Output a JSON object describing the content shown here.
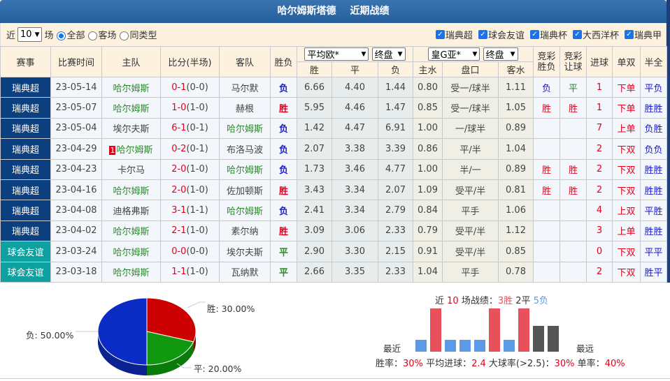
{
  "title": {
    "team": "哈尔姆斯塔德",
    "section": "近期战绩"
  },
  "team_short": "哈尔姆斯",
  "filter": {
    "prefix": "近",
    "count": "10",
    "suffix": "场",
    "radios": [
      {
        "label": "全部",
        "checked": true
      },
      {
        "label": "客场",
        "checked": false
      },
      {
        "label": "同类型",
        "checked": false
      }
    ],
    "leagues": [
      {
        "label": "瑞典超",
        "checked": true
      },
      {
        "label": "球会友谊",
        "checked": true
      },
      {
        "label": "瑞典杯",
        "checked": true
      },
      {
        "label": "大西洋杯",
        "checked": true
      },
      {
        "label": "瑞典甲",
        "checked": true
      }
    ]
  },
  "headers": {
    "league": "赛事",
    "time": "比赛时间",
    "home": "主队",
    "score": "比分(半场)",
    "away": "客队",
    "result": "胜负",
    "euro_select": "平均欧*",
    "euro_type": "终盘",
    "asia_select": "皇G亚*",
    "asia_type": "终盘",
    "win": "胜",
    "draw": "平",
    "lose": "负",
    "home_water": "主水",
    "handicap": "盘口",
    "away_water": "客水",
    "jc_result": "竞彩胜负",
    "jc_handicap": "竞彩让球",
    "goals": "进球",
    "oddeven": "单双",
    "htft": "半全"
  },
  "rows": [
    {
      "league": "瑞典超",
      "friendly": false,
      "date": "23-05-14",
      "home": "哈尔姆斯",
      "badge": "",
      "ft": "0-1",
      "ht": "(0-0)",
      "away": "马尔默",
      "result": "负",
      "w": "6.66",
      "d": "4.40",
      "l": "1.44",
      "hw": "0.80",
      "hc": "受一/球半",
      "aw": "1.11",
      "jc1": "负",
      "jc2": "平",
      "goals": "1",
      "oe": "下单",
      "htft": "平负"
    },
    {
      "league": "瑞典超",
      "friendly": false,
      "date": "23-05-07",
      "home": "哈尔姆斯",
      "badge": "",
      "ft": "1-0",
      "ht": "(1-0)",
      "away": "赫根",
      "result": "胜",
      "w": "5.95",
      "d": "4.46",
      "l": "1.47",
      "hw": "0.85",
      "hc": "受一/球半",
      "aw": "1.05",
      "jc1": "胜",
      "jc2": "胜",
      "goals": "1",
      "oe": "下单",
      "htft": "胜胜"
    },
    {
      "league": "瑞典超",
      "friendly": false,
      "date": "23-05-04",
      "home": "埃尔夫斯",
      "badge": "",
      "ft": "6-1",
      "ht": "(0-1)",
      "away": "哈尔姆斯",
      "result": "负",
      "w": "1.42",
      "d": "4.47",
      "l": "6.91",
      "hw": "1.00",
      "hc": "一/球半",
      "aw": "0.89",
      "jc1": "",
      "jc2": "",
      "goals": "7",
      "oe": "上单",
      "htft": "负胜"
    },
    {
      "league": "瑞典超",
      "friendly": false,
      "date": "23-04-29",
      "home": "哈尔姆斯",
      "badge": "1",
      "ft": "0-2",
      "ht": "(0-1)",
      "away": "布洛马波",
      "result": "负",
      "w": "2.07",
      "d": "3.38",
      "l": "3.39",
      "hw": "0.86",
      "hc": "平/半",
      "aw": "1.04",
      "jc1": "",
      "jc2": "",
      "goals": "2",
      "oe": "下双",
      "htft": "负负"
    },
    {
      "league": "瑞典超",
      "friendly": false,
      "date": "23-04-23",
      "home": "卡尔马",
      "badge": "",
      "ft": "2-0",
      "ht": "(1-0)",
      "away": "哈尔姆斯",
      "result": "负",
      "w": "1.73",
      "d": "3.46",
      "l": "4.77",
      "hw": "1.00",
      "hc": "半/一",
      "aw": "0.89",
      "jc1": "胜",
      "jc2": "胜",
      "goals": "2",
      "oe": "下双",
      "htft": "胜胜"
    },
    {
      "league": "瑞典超",
      "friendly": false,
      "date": "23-04-16",
      "home": "哈尔姆斯",
      "badge": "",
      "ft": "2-0",
      "ht": "(1-0)",
      "away": "佐加顿斯",
      "result": "胜",
      "w": "3.43",
      "d": "3.34",
      "l": "2.07",
      "hw": "1.09",
      "hc": "受平/半",
      "aw": "0.81",
      "jc1": "胜",
      "jc2": "胜",
      "goals": "2",
      "oe": "下双",
      "htft": "胜胜"
    },
    {
      "league": "瑞典超",
      "friendly": false,
      "date": "23-04-08",
      "home": "迪格弗斯",
      "badge": "",
      "ft": "3-1",
      "ht": "(1-1)",
      "away": "哈尔姆斯",
      "result": "负",
      "w": "2.41",
      "d": "3.34",
      "l": "2.79",
      "hw": "0.84",
      "hc": "平手",
      "aw": "1.06",
      "jc1": "",
      "jc2": "",
      "goals": "4",
      "oe": "上双",
      "htft": "平胜"
    },
    {
      "league": "瑞典超",
      "friendly": false,
      "date": "23-04-02",
      "home": "哈尔姆斯",
      "badge": "",
      "ft": "2-1",
      "ht": "(1-0)",
      "away": "素尔纳",
      "result": "胜",
      "w": "3.09",
      "d": "3.06",
      "l": "2.33",
      "hw": "0.79",
      "hc": "受平/半",
      "aw": "1.12",
      "jc1": "",
      "jc2": "",
      "goals": "3",
      "oe": "上单",
      "htft": "胜胜"
    },
    {
      "league": "球会友谊",
      "friendly": true,
      "date": "23-03-24",
      "home": "哈尔姆斯",
      "badge": "",
      "ft": "0-0",
      "ht": "(0-0)",
      "away": "埃尔夫斯",
      "result": "平",
      "w": "2.90",
      "d": "3.30",
      "l": "2.15",
      "hw": "0.91",
      "hc": "受平/半",
      "aw": "0.85",
      "jc1": "",
      "jc2": "",
      "goals": "0",
      "oe": "下双",
      "htft": "平平"
    },
    {
      "league": "球会友谊",
      "friendly": true,
      "date": "23-03-18",
      "home": "哈尔姆斯",
      "badge": "",
      "ft": "1-1",
      "ht": "(1-0)",
      "away": "瓦纳默",
      "result": "平",
      "w": "2.66",
      "d": "3.35",
      "l": "2.33",
      "hw": "1.04",
      "hc": "平手",
      "aw": "0.78",
      "jc1": "",
      "jc2": "",
      "goals": "2",
      "oe": "下双",
      "htft": "胜平"
    }
  ],
  "pie": {
    "slices": [
      {
        "label": "胜",
        "value": 30,
        "text": "胜: 30.00%",
        "color": "#cc0000",
        "side": "#990000"
      },
      {
        "label": "平",
        "value": 20,
        "text": "平: 20.00%",
        "color": "#109910",
        "side": "#0a7a0a"
      },
      {
        "label": "负",
        "value": 50,
        "text": "负: 50.00%",
        "color": "#0a2bc4",
        "side": "#0a2290"
      }
    ]
  },
  "summary": {
    "p1": "近",
    "count": "10",
    "p2": "场战绩：",
    "wins": "3胜",
    "draws": "2平",
    "losses": "5负",
    "recent": "最近",
    "oldest": "最远",
    "win_rate_label": "胜率：",
    "win_rate": "30%",
    "avg_goals_label": "平均进球：",
    "avg_goals": "2.4",
    "over_label": "大球率(>2.5)：",
    "over_rate": "30%",
    "odd_label": "单率：",
    "odd_rate": "40%",
    "results": [
      "负",
      "胜",
      "负",
      "负",
      "负",
      "胜",
      "负",
      "胜",
      "平",
      "平"
    ]
  },
  "colors": {
    "win": "#e8505b",
    "lose": "#5b9be6",
    "draw": "#555555"
  }
}
